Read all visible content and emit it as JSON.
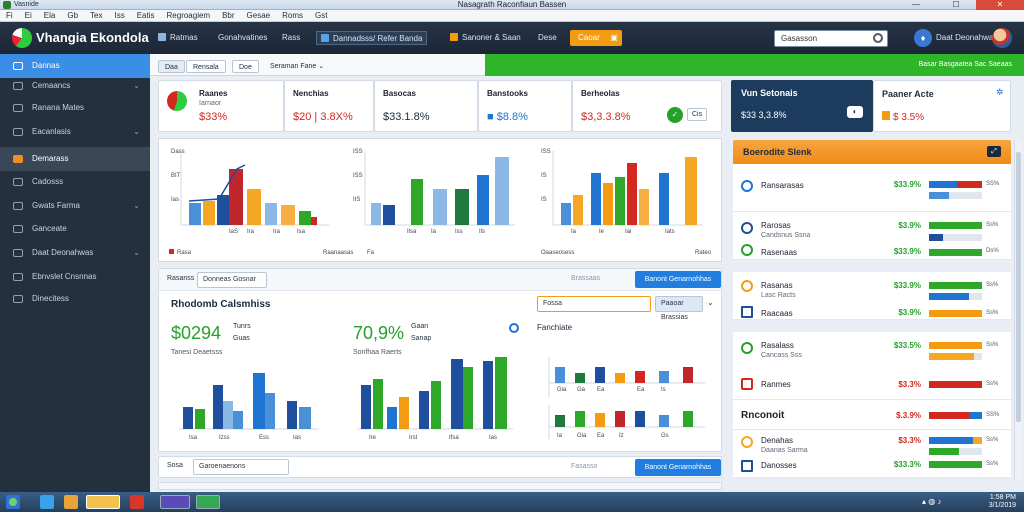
{
  "window": {
    "title": "Nasagrath Raconfiaun Bassen",
    "app_name": "Vasnide"
  },
  "menu": [
    "Fi",
    "Ei",
    "Ela",
    "Gb",
    "Tex",
    "Iss",
    "Eatis",
    "Regroagiem",
    "Bbr",
    "Gesae",
    "Roms",
    "Gst"
  ],
  "topbar": {
    "brand": "Vhangia Ekondola",
    "items": [
      "Ratmas",
      "Gonahvatines",
      "Rass",
      "Dannadsss/ Refer Banda",
      "Sanoner & Saan",
      "Dese"
    ],
    "orange_button": "Caoar",
    "search_value": "Gasasson"
  },
  "sidebar": {
    "items": [
      "Dannas",
      "Cemaancs",
      "Ranana Mates",
      "Eacanlasis",
      "Demarass",
      "Cadosss",
      "Gwats Farma",
      "Ganceate",
      "Daat Deonahwas",
      "Ebnvslet Cnsnnas",
      "Dinecitess"
    ]
  },
  "tabs": [
    "Daa",
    "Rensala",
    "Doe",
    "Seraman Fane"
  ],
  "greenbar_text": "Basar Basgaatea Sac Saeaas",
  "kpis": [
    {
      "label": "Raanes",
      "sub": "Iarnaor",
      "value": "$33%"
    },
    {
      "label": "Nenchias",
      "value": "$20 | 3.8X%"
    },
    {
      "label": "Basocas",
      "value": "$33.1.8%"
    },
    {
      "label": "Banstooks",
      "value": "■ $8.8%"
    },
    {
      "label": "Berheolas",
      "value": "$3,3.3.8%",
      "badge": "Cis"
    }
  ],
  "top_charts": [
    {
      "legend_left": "Rasa",
      "legend_right": ""
    },
    {
      "legend_left": "Raanaasas",
      "legend_right": "Fa"
    },
    {
      "legend_left": "Oaaseosess",
      "legend_right": "Rateo"
    }
  ],
  "analytics": {
    "filter_label": "Rasanss",
    "filter_value": "Donneas Gosnar",
    "search_placeholder": "Brassaas",
    "button": "Banont Genarnohhas",
    "title": "Rhodomb Calsmhiss",
    "dropdown_value": "Fossa",
    "secondary_button": "Paaoar Brassias",
    "metric1": {
      "value": "$0294",
      "tag1": "Tunrs",
      "tag2": "Guas",
      "sub": "Tanesi Deaetsss"
    },
    "metric2": {
      "value": "70,9%",
      "tag1": "Gaan",
      "tag2": "Sanap",
      "sub": "Sonfhaa Raerts"
    },
    "chart3_title": "Fanchiate"
  },
  "footer_row": {
    "label": "Sosa",
    "field": "Garoenaenons",
    "placeholder": "Fasasso",
    "button": "Banont Genarnohhas"
  },
  "right_panel": {
    "card_title": "Vun Setonais",
    "card_value": "$33 3,3.8%",
    "card2_label": "Paaner Acte",
    "card2_value": "$ 3.5%",
    "header": "Boerodite Slenk",
    "rows": [
      {
        "name": "Ransarasas",
        "sub": "",
        "pct": "$33.9%",
        "small": "SS%"
      },
      {
        "name": "Rarosas",
        "sub": "Candsnus Ssna",
        "pct": "$3.9%",
        "small": "Ss%"
      },
      {
        "name": "Rasenaas",
        "sub": "",
        "pct": "$33.9%",
        "small": "Ds%"
      },
      {
        "name": "Rasanas",
        "sub": "Lasc Racts",
        "pct": "$33.9%",
        "small": "Ss%"
      },
      {
        "name": "Raacaas",
        "sub": "",
        "pct": "$3.9%",
        "small": "Ss%"
      },
      {
        "name": "Rasalass",
        "sub": "Cancass Sss",
        "pct": "$33.5%",
        "small": "Ss%"
      },
      {
        "name": "Ranmes",
        "sub": "",
        "pct": "$3.3%",
        "small": "Ss%"
      },
      {
        "name": "Rnconoit",
        "sub": "",
        "pct": "$.3.9%",
        "small": "SS%"
      },
      {
        "name": "Denahas",
        "sub": "Daanas Sarma",
        "pct": "$3.3%",
        "small": "Ss%"
      },
      {
        "name": "Danosses",
        "sub": "",
        "pct": "$33.3%",
        "small": "Ss%"
      }
    ]
  },
  "taskbar": {
    "time": "1:58 PM",
    "date": "3/1/2019"
  },
  "colors": {
    "brand_dark": "#1c2736",
    "accent_blue": "#1f7ee0",
    "accent_green": "#2fb52a",
    "accent_orange": "#f39c12",
    "accent_red": "#d3281f"
  }
}
